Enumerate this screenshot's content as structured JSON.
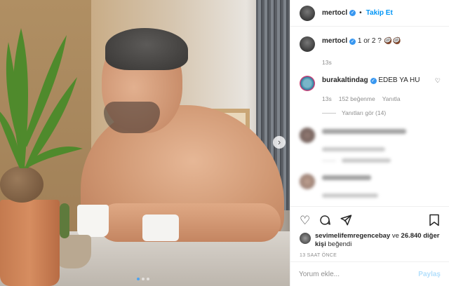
{
  "post": {
    "username": "mertocl",
    "follow_label": "Takip Et",
    "caption": "1 or 2 ? 🥥🥥",
    "caption_time": "13s"
  },
  "comments": [
    {
      "username": "burakaltindag",
      "text": "EDEB YA HU",
      "time": "13s",
      "likes": "152 beğenme",
      "reply_label": "Yanıtla",
      "view_replies": "Yanıtları gör (14)"
    }
  ],
  "likes": {
    "user": "sevimelifemregencebay",
    "connector": "ve",
    "others": "26.840 diğer kişi",
    "suffix": "beğendi"
  },
  "time_ago": "13 SAAT ÖNCE",
  "add_comment": {
    "placeholder": "Yorum ekle...",
    "post_label": "Paylaş"
  },
  "carousel": {
    "slides": 3,
    "active": 1
  }
}
